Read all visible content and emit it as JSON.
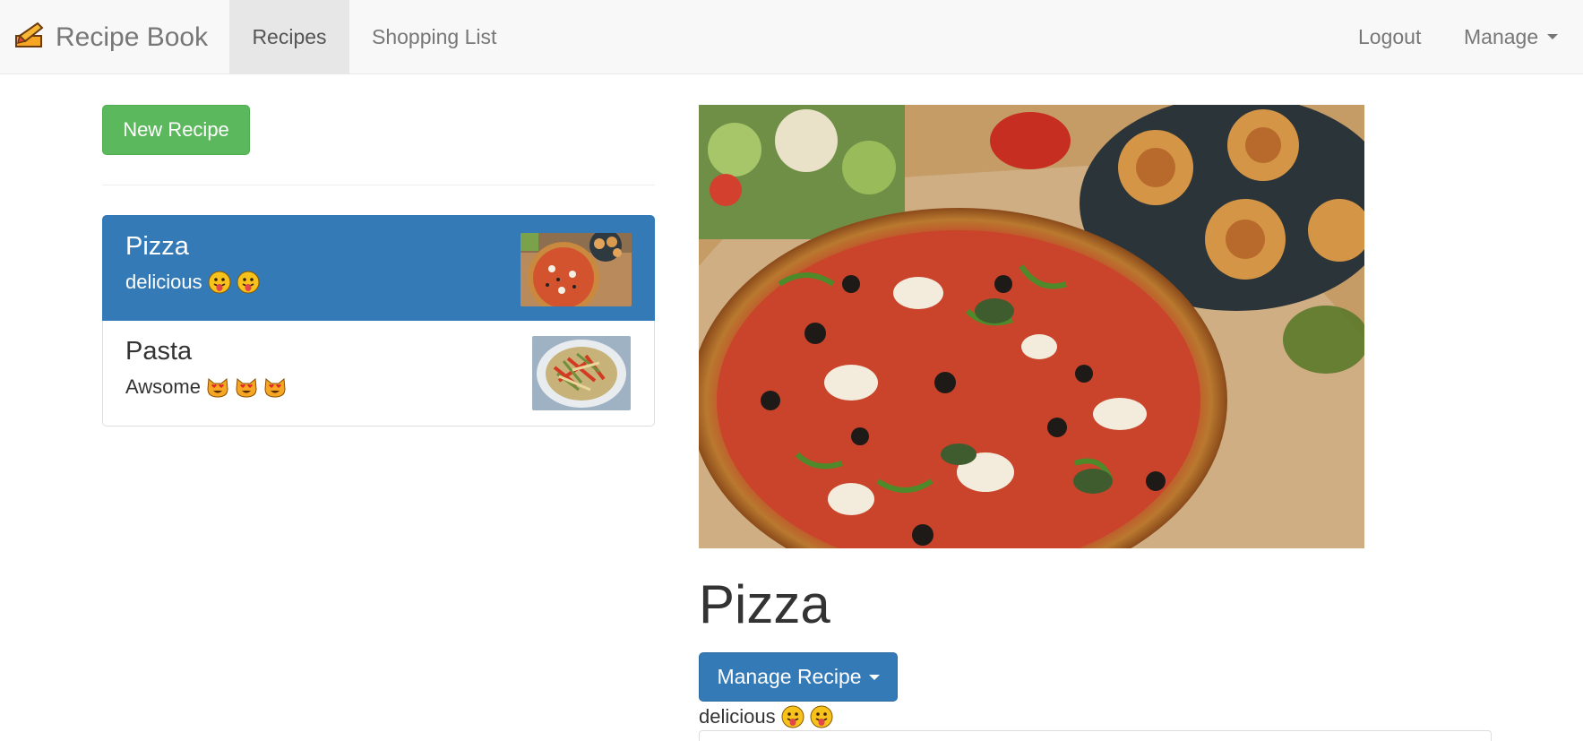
{
  "navbar": {
    "brand_label": "Recipe Book",
    "links": {
      "recipes": "Recipes",
      "shopping_list": "Shopping List",
      "logout": "Logout",
      "manage": "Manage"
    },
    "active_link": "recipes"
  },
  "sidebar": {
    "new_recipe_label": "New Recipe",
    "recipes": [
      {
        "name": "Pizza",
        "description": "delicious",
        "emoji": [
          "face-with-tongue",
          "face-with-tongue"
        ],
        "active": true
      },
      {
        "name": "Pasta",
        "description": "Awsome",
        "emoji": [
          "smiling-cat-heart-eyes",
          "smiling-cat-heart-eyes",
          "smiling-cat-heart-eyes"
        ],
        "active": false
      }
    ]
  },
  "detail": {
    "title": "Pizza",
    "manage_button_label": "Manage Recipe",
    "description": "delicious",
    "emoji": [
      "face-with-tongue",
      "face-with-tongue"
    ]
  },
  "colors": {
    "navbar_bg": "#f8f8f8",
    "success": "#5cb85c",
    "primary": "#337ab7",
    "text": "#333333",
    "nav_text": "#777777"
  }
}
